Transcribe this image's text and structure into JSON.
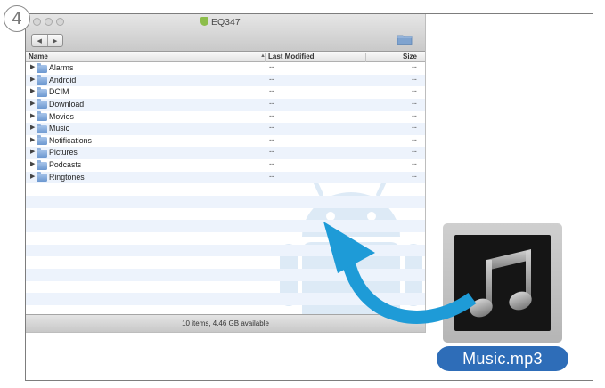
{
  "step": {
    "number": "4"
  },
  "window": {
    "title": "EQ347"
  },
  "toolbar": {
    "back_label": "◀",
    "forward_label": "▶"
  },
  "columns": {
    "name": "Name",
    "last_modified": "Last Modified",
    "size": "Size"
  },
  "rows": [
    {
      "name": "Alarms",
      "modified": "--",
      "size": "--"
    },
    {
      "name": "Android",
      "modified": "--",
      "size": "--"
    },
    {
      "name": "DCIM",
      "modified": "--",
      "size": "--"
    },
    {
      "name": "Download",
      "modified": "--",
      "size": "--"
    },
    {
      "name": "Movies",
      "modified": "--",
      "size": "--"
    },
    {
      "name": "Music",
      "modified": "--",
      "size": "--"
    },
    {
      "name": "Notifications",
      "modified": "--",
      "size": "--"
    },
    {
      "name": "Pictures",
      "modified": "--",
      "size": "--"
    },
    {
      "name": "Podcasts",
      "modified": "--",
      "size": "--"
    },
    {
      "name": "Ringtones",
      "modified": "--",
      "size": "--"
    }
  ],
  "status_bar": {
    "text": "10 items, 4.46 GB available"
  },
  "file": {
    "name": "Music.mp3",
    "icon": "music-note-icon"
  },
  "colors": {
    "arrow": "#1e9bd7",
    "file_label_bg": "#2e6db8",
    "row_stripe": "#edf3fc",
    "folder_icon": "#6b97cf",
    "android_watermark": "#c3d9ef"
  }
}
